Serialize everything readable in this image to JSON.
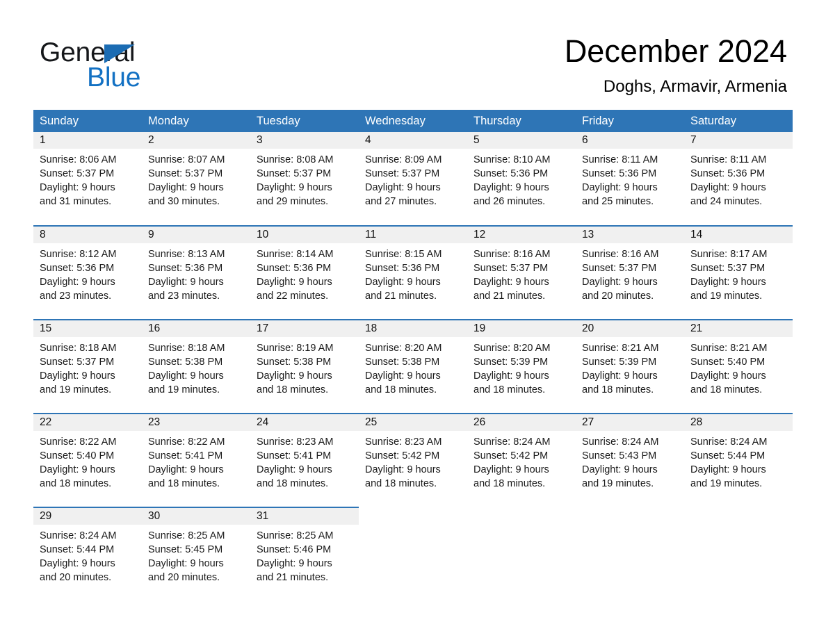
{
  "brand": {
    "name_part1": "General",
    "name_part2": "Blue",
    "accent_color": "#1371c3",
    "triangle_color": "#1b6cb3"
  },
  "header": {
    "month_title": "December 2024",
    "location": "Doghs, Armavir, Armenia"
  },
  "calendar": {
    "header_bg": "#2e75b6",
    "date_band_bg": "#f0f0f0",
    "weekdays": [
      "Sunday",
      "Monday",
      "Tuesday",
      "Wednesday",
      "Thursday",
      "Friday",
      "Saturday"
    ],
    "weeks": [
      [
        {
          "date": "1",
          "sunrise": "Sunrise: 8:06 AM",
          "sunset": "Sunset: 5:37 PM",
          "daylight_line1": "Daylight: 9 hours",
          "daylight_line2": "and 31 minutes."
        },
        {
          "date": "2",
          "sunrise": "Sunrise: 8:07 AM",
          "sunset": "Sunset: 5:37 PM",
          "daylight_line1": "Daylight: 9 hours",
          "daylight_line2": "and 30 minutes."
        },
        {
          "date": "3",
          "sunrise": "Sunrise: 8:08 AM",
          "sunset": "Sunset: 5:37 PM",
          "daylight_line1": "Daylight: 9 hours",
          "daylight_line2": "and 29 minutes."
        },
        {
          "date": "4",
          "sunrise": "Sunrise: 8:09 AM",
          "sunset": "Sunset: 5:37 PM",
          "daylight_line1": "Daylight: 9 hours",
          "daylight_line2": "and 27 minutes."
        },
        {
          "date": "5",
          "sunrise": "Sunrise: 8:10 AM",
          "sunset": "Sunset: 5:36 PM",
          "daylight_line1": "Daylight: 9 hours",
          "daylight_line2": "and 26 minutes."
        },
        {
          "date": "6",
          "sunrise": "Sunrise: 8:11 AM",
          "sunset": "Sunset: 5:36 PM",
          "daylight_line1": "Daylight: 9 hours",
          "daylight_line2": "and 25 minutes."
        },
        {
          "date": "7",
          "sunrise": "Sunrise: 8:11 AM",
          "sunset": "Sunset: 5:36 PM",
          "daylight_line1": "Daylight: 9 hours",
          "daylight_line2": "and 24 minutes."
        }
      ],
      [
        {
          "date": "8",
          "sunrise": "Sunrise: 8:12 AM",
          "sunset": "Sunset: 5:36 PM",
          "daylight_line1": "Daylight: 9 hours",
          "daylight_line2": "and 23 minutes."
        },
        {
          "date": "9",
          "sunrise": "Sunrise: 8:13 AM",
          "sunset": "Sunset: 5:36 PM",
          "daylight_line1": "Daylight: 9 hours",
          "daylight_line2": "and 23 minutes."
        },
        {
          "date": "10",
          "sunrise": "Sunrise: 8:14 AM",
          "sunset": "Sunset: 5:36 PM",
          "daylight_line1": "Daylight: 9 hours",
          "daylight_line2": "and 22 minutes."
        },
        {
          "date": "11",
          "sunrise": "Sunrise: 8:15 AM",
          "sunset": "Sunset: 5:36 PM",
          "daylight_line1": "Daylight: 9 hours",
          "daylight_line2": "and 21 minutes."
        },
        {
          "date": "12",
          "sunrise": "Sunrise: 8:16 AM",
          "sunset": "Sunset: 5:37 PM",
          "daylight_line1": "Daylight: 9 hours",
          "daylight_line2": "and 21 minutes."
        },
        {
          "date": "13",
          "sunrise": "Sunrise: 8:16 AM",
          "sunset": "Sunset: 5:37 PM",
          "daylight_line1": "Daylight: 9 hours",
          "daylight_line2": "and 20 minutes."
        },
        {
          "date": "14",
          "sunrise": "Sunrise: 8:17 AM",
          "sunset": "Sunset: 5:37 PM",
          "daylight_line1": "Daylight: 9 hours",
          "daylight_line2": "and 19 minutes."
        }
      ],
      [
        {
          "date": "15",
          "sunrise": "Sunrise: 8:18 AM",
          "sunset": "Sunset: 5:37 PM",
          "daylight_line1": "Daylight: 9 hours",
          "daylight_line2": "and 19 minutes."
        },
        {
          "date": "16",
          "sunrise": "Sunrise: 8:18 AM",
          "sunset": "Sunset: 5:38 PM",
          "daylight_line1": "Daylight: 9 hours",
          "daylight_line2": "and 19 minutes."
        },
        {
          "date": "17",
          "sunrise": "Sunrise: 8:19 AM",
          "sunset": "Sunset: 5:38 PM",
          "daylight_line1": "Daylight: 9 hours",
          "daylight_line2": "and 18 minutes."
        },
        {
          "date": "18",
          "sunrise": "Sunrise: 8:20 AM",
          "sunset": "Sunset: 5:38 PM",
          "daylight_line1": "Daylight: 9 hours",
          "daylight_line2": "and 18 minutes."
        },
        {
          "date": "19",
          "sunrise": "Sunrise: 8:20 AM",
          "sunset": "Sunset: 5:39 PM",
          "daylight_line1": "Daylight: 9 hours",
          "daylight_line2": "and 18 minutes."
        },
        {
          "date": "20",
          "sunrise": "Sunrise: 8:21 AM",
          "sunset": "Sunset: 5:39 PM",
          "daylight_line1": "Daylight: 9 hours",
          "daylight_line2": "and 18 minutes."
        },
        {
          "date": "21",
          "sunrise": "Sunrise: 8:21 AM",
          "sunset": "Sunset: 5:40 PM",
          "daylight_line1": "Daylight: 9 hours",
          "daylight_line2": "and 18 minutes."
        }
      ],
      [
        {
          "date": "22",
          "sunrise": "Sunrise: 8:22 AM",
          "sunset": "Sunset: 5:40 PM",
          "daylight_line1": "Daylight: 9 hours",
          "daylight_line2": "and 18 minutes."
        },
        {
          "date": "23",
          "sunrise": "Sunrise: 8:22 AM",
          "sunset": "Sunset: 5:41 PM",
          "daylight_line1": "Daylight: 9 hours",
          "daylight_line2": "and 18 minutes."
        },
        {
          "date": "24",
          "sunrise": "Sunrise: 8:23 AM",
          "sunset": "Sunset: 5:41 PM",
          "daylight_line1": "Daylight: 9 hours",
          "daylight_line2": "and 18 minutes."
        },
        {
          "date": "25",
          "sunrise": "Sunrise: 8:23 AM",
          "sunset": "Sunset: 5:42 PM",
          "daylight_line1": "Daylight: 9 hours",
          "daylight_line2": "and 18 minutes."
        },
        {
          "date": "26",
          "sunrise": "Sunrise: 8:24 AM",
          "sunset": "Sunset: 5:42 PM",
          "daylight_line1": "Daylight: 9 hours",
          "daylight_line2": "and 18 minutes."
        },
        {
          "date": "27",
          "sunrise": "Sunrise: 8:24 AM",
          "sunset": "Sunset: 5:43 PM",
          "daylight_line1": "Daylight: 9 hours",
          "daylight_line2": "and 19 minutes."
        },
        {
          "date": "28",
          "sunrise": "Sunrise: 8:24 AM",
          "sunset": "Sunset: 5:44 PM",
          "daylight_line1": "Daylight: 9 hours",
          "daylight_line2": "and 19 minutes."
        }
      ],
      [
        {
          "date": "29",
          "sunrise": "Sunrise: 8:24 AM",
          "sunset": "Sunset: 5:44 PM",
          "daylight_line1": "Daylight: 9 hours",
          "daylight_line2": "and 20 minutes."
        },
        {
          "date": "30",
          "sunrise": "Sunrise: 8:25 AM",
          "sunset": "Sunset: 5:45 PM",
          "daylight_line1": "Daylight: 9 hours",
          "daylight_line2": "and 20 minutes."
        },
        {
          "date": "31",
          "sunrise": "Sunrise: 8:25 AM",
          "sunset": "Sunset: 5:46 PM",
          "daylight_line1": "Daylight: 9 hours",
          "daylight_line2": "and 21 minutes."
        },
        {
          "date": "",
          "sunrise": "",
          "sunset": "",
          "daylight_line1": "",
          "daylight_line2": ""
        },
        {
          "date": "",
          "sunrise": "",
          "sunset": "",
          "daylight_line1": "",
          "daylight_line2": ""
        },
        {
          "date": "",
          "sunrise": "",
          "sunset": "",
          "daylight_line1": "",
          "daylight_line2": ""
        },
        {
          "date": "",
          "sunrise": "",
          "sunset": "",
          "daylight_line1": "",
          "daylight_line2": ""
        }
      ]
    ]
  }
}
